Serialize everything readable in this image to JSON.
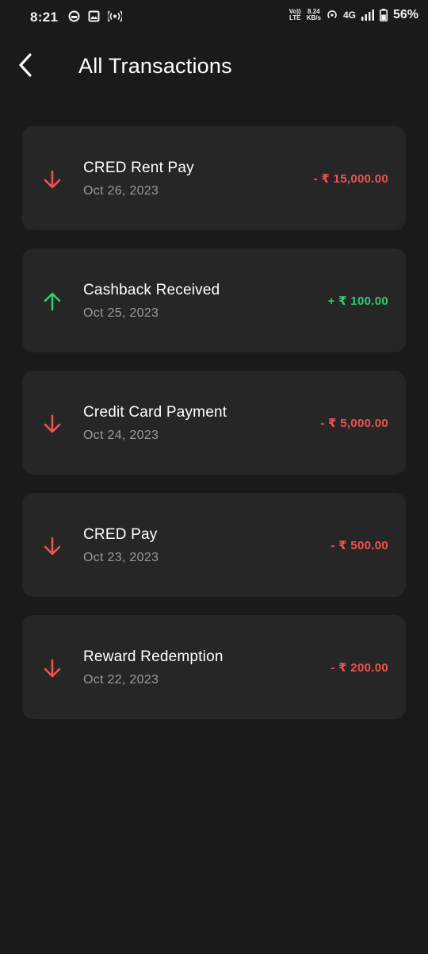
{
  "status_bar": {
    "time": "8:21",
    "volte_top": "Vo))",
    "volte_bottom": "LTE",
    "speed_top": "8.24",
    "speed_bottom": "KB/s",
    "network": "4G",
    "battery": "56%"
  },
  "header": {
    "title": "All Transactions",
    "back_icon": "chevron-left-icon"
  },
  "colors": {
    "background": "#1a1a1a",
    "card": "#262626",
    "debit": "#ef5350",
    "credit": "#2ecc71",
    "date": "#9a9a9a"
  },
  "transactions": [
    {
      "name": "CRED Rent Pay",
      "date": "Oct 26, 2023",
      "amount": "- ₹ 15,000.00",
      "direction": "debit",
      "icon": "arrow-down-icon"
    },
    {
      "name": "Cashback Received",
      "date": "Oct 25, 2023",
      "amount": "+ ₹ 100.00",
      "direction": "credit",
      "icon": "arrow-up-icon"
    },
    {
      "name": "Credit Card Payment",
      "date": "Oct 24, 2023",
      "amount": "- ₹ 5,000.00",
      "direction": "debit",
      "icon": "arrow-down-icon"
    },
    {
      "name": "CRED Pay",
      "date": "Oct 23, 2023",
      "amount": "- ₹ 500.00",
      "direction": "debit",
      "icon": "arrow-down-icon"
    },
    {
      "name": "Reward Redemption",
      "date": "Oct 22, 2023",
      "amount": "- ₹ 200.00",
      "direction": "debit",
      "icon": "arrow-down-icon"
    }
  ]
}
